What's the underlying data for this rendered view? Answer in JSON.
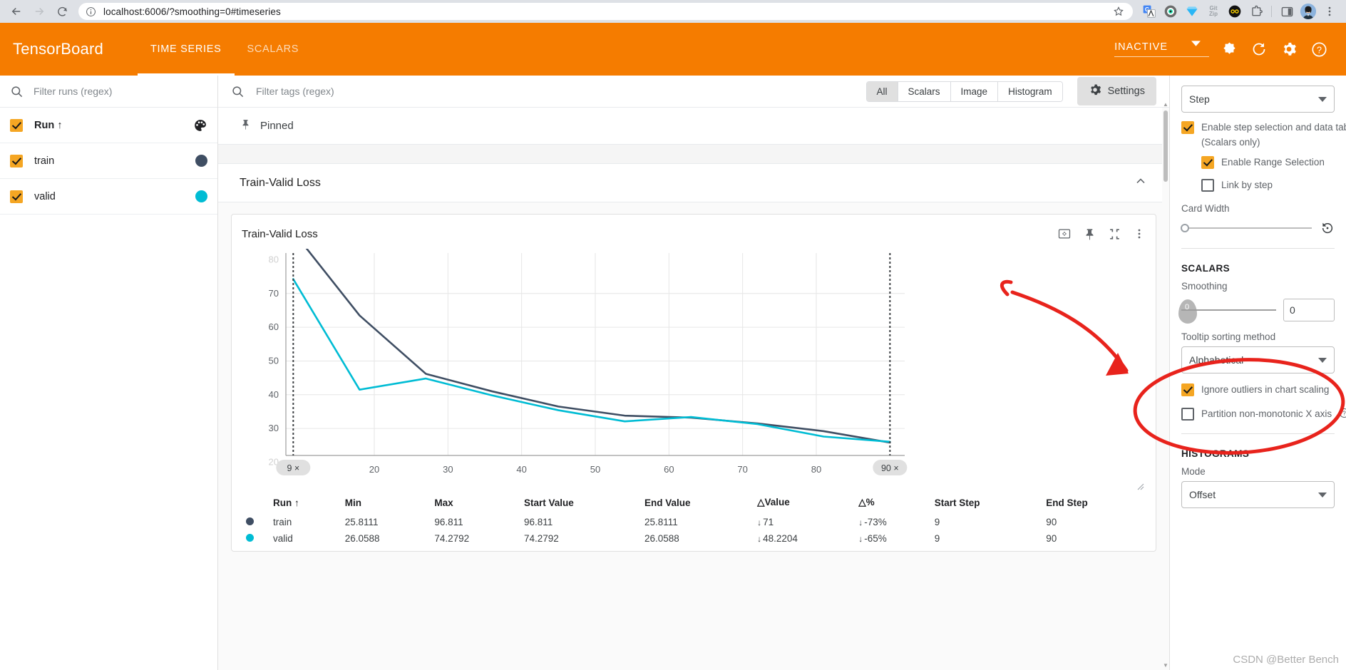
{
  "browser": {
    "url": "localhost:6006/?smoothing=0#timeseries",
    "back_icon": "back-arrow-icon",
    "forward_icon": "forward-arrow-icon",
    "reload_icon": "reload-icon",
    "site_info_icon": "site-info-icon",
    "bookmark_icon": "star-icon",
    "extensions": [
      "google-translate-icon",
      "eye-tracker-icon",
      "diamond-icon",
      "gitzip-icon",
      "infinity-icon",
      "puzzle-extensions-icon",
      "side-panel-icon"
    ],
    "gitzip_line1": "Git",
    "gitzip_line2": "Zip",
    "profile_icon": "user-avatar",
    "menu_icon": "three-dots-menu-icon"
  },
  "header": {
    "logo": "TensorBoard",
    "tabs": [
      {
        "label": "TIME SERIES",
        "active": true
      },
      {
        "label": "SCALARS",
        "active": false
      }
    ],
    "reload_status": "INACTIVE",
    "icons": [
      "brightness-icon",
      "reload-icon",
      "settings-gear-icon",
      "help-question-icon"
    ],
    "accent_color": "#f57c00"
  },
  "runs_panel": {
    "filter_placeholder": "Filter runs (regex)",
    "filter_value": "",
    "search_icon": "search-icon",
    "palette_icon": "color-palette-icon",
    "header_row": {
      "label": "Run",
      "sort_arrow": "↑",
      "checked": true
    },
    "runs": [
      {
        "name": "train",
        "checked": true,
        "color": "#3f4e63"
      },
      {
        "name": "valid",
        "checked": true,
        "color": "#00bcd4"
      }
    ]
  },
  "tags_bar": {
    "filter_placeholder": "Filter tags (regex)",
    "filter_value": "",
    "search_icon": "search-icon",
    "segments": [
      {
        "label": "All",
        "active": true
      },
      {
        "label": "Scalars",
        "active": false
      },
      {
        "label": "Image",
        "active": false
      },
      {
        "label": "Histogram",
        "active": false
      }
    ],
    "settings_label": "Settings",
    "settings_icon": "settings-gear-icon"
  },
  "main": {
    "pinned_label": "Pinned",
    "pinned_icon": "pin-icon",
    "group_title": "Train-Valid Loss",
    "group_collapse_icon": "chevron-up-icon",
    "card": {
      "title": "Train-Valid Loss",
      "actions": [
        {
          "icon": "fit-to-domain-icon",
          "name": "fit-to-domain-button"
        },
        {
          "icon": "pin-icon",
          "name": "pin-card-button"
        },
        {
          "icon": "collapse-icon",
          "name": "toggle-fullsize-button"
        },
        {
          "icon": "more-vert-icon",
          "name": "card-menu-button"
        }
      ]
    },
    "table": {
      "columns": [
        "Run ↑",
        "Min",
        "Max",
        "Start Value",
        "End Value",
        "△Value",
        "△%",
        "Start Step",
        "End Step"
      ],
      "rows": [
        {
          "color": "#3f4e63",
          "run": "train",
          "min": "25.8111",
          "max": "96.811",
          "start_value": "96.811",
          "end_value": "25.8111",
          "delta_value": "71",
          "delta_value_arrow": "↓",
          "delta_pct": "-73%",
          "delta_pct_arrow": "↓",
          "start_step": "9",
          "end_step": "90"
        },
        {
          "color": "#00bcd4",
          "run": "valid",
          "min": "26.0588",
          "max": "74.2792",
          "start_value": "74.2792",
          "end_value": "26.0588",
          "delta_value": "48.2204",
          "delta_value_arrow": "↓",
          "delta_pct": "-65%",
          "delta_pct_arrow": "↓",
          "start_step": "9",
          "end_step": "90"
        }
      ]
    }
  },
  "chart_data": {
    "type": "line",
    "title": "Train-Valid Loss",
    "xlabel": "",
    "ylabel": "",
    "xlim": [
      8,
      92
    ],
    "ylim": [
      22,
      82
    ],
    "xticks": [
      20,
      30,
      40,
      50,
      60,
      70,
      80
    ],
    "yticks": [
      30,
      40,
      50,
      60,
      70
    ],
    "grid": true,
    "legend_position": "table-below",
    "range_selection": {
      "start_step": 9,
      "end_step": 90,
      "start_label": "9 ×",
      "end_label": "90 ×"
    },
    "series": [
      {
        "name": "train",
        "color": "#3f4e63",
        "x": [
          9,
          18,
          27,
          36,
          45,
          54,
          63,
          72,
          81,
          90
        ],
        "y": [
          96.811,
          63.5,
          46.2,
          41.0,
          36.5,
          33.8,
          33.2,
          31.5,
          29.2,
          25.8111
        ]
      },
      {
        "name": "valid",
        "color": "#00bcd4",
        "x": [
          9,
          18,
          27,
          36,
          45,
          54,
          63,
          72,
          81,
          90
        ],
        "y": [
          74.2792,
          41.5,
          44.8,
          39.8,
          35.4,
          32.1,
          33.4,
          31.3,
          27.6,
          26.0588
        ]
      }
    ]
  },
  "settings": {
    "x_axis_select": "Step",
    "enable_step_selection": {
      "label": "Enable step selection and data table",
      "checked": true
    },
    "scalars_only_note": "(Scalars only)",
    "enable_range_selection": {
      "label": "Enable Range Selection",
      "checked": true
    },
    "link_by_step": {
      "label": "Link by step",
      "checked": false
    },
    "card_width_label": "Card Width",
    "card_width_reset_icon": "reset-icon",
    "scalars_section": "SCALARS",
    "smoothing_label": "Smoothing",
    "smoothing_value": "0",
    "smoothing_tooltip": "0",
    "tooltip_sorting_label": "Tooltip sorting method",
    "tooltip_sorting_value": "Alphabetical",
    "ignore_outliers": {
      "label": "Ignore outliers in chart scaling",
      "checked": true
    },
    "partition_x_axis": {
      "label": "Partition non-monotonic X axis",
      "checked": false,
      "help_icon": "help-question-icon"
    },
    "histograms_section": "HISTOGRAMS",
    "histogram_mode_label": "Mode",
    "histogram_mode_value": "Offset"
  },
  "watermark": "CSDN @Better Bench",
  "annotation": {
    "color": "#e8231c",
    "shape": "arrow-and-ellipse"
  }
}
